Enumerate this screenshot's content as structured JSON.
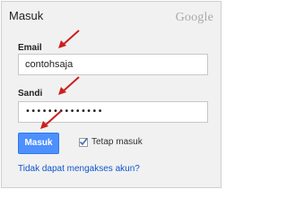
{
  "header": {
    "title": "Masuk",
    "logo_text": "Google"
  },
  "form": {
    "email_label": "Email",
    "email_value": "contohsaja",
    "password_label": "Sandi",
    "password_value": "••••••••••••••",
    "submit_label": "Masuk",
    "remember_label": "Tetap masuk",
    "remember_checked": true,
    "help_link": "Tidak dapat mengakses akun?"
  },
  "colors": {
    "primary_button": "#4d90fe",
    "link": "#1155cc",
    "annotation_arrow": "#cc1f1f"
  },
  "icons": {
    "arrow": "red-arrow-icon",
    "check": "check-icon"
  }
}
